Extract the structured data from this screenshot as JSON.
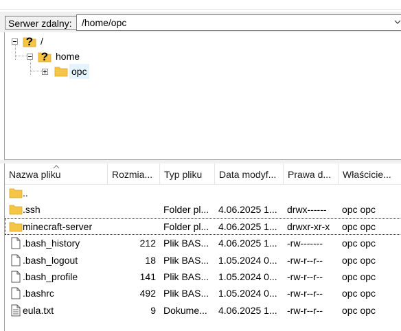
{
  "path_bar": {
    "label": "Serwer zdalny:",
    "value": "/home/opc"
  },
  "tree": [
    {
      "label": "/"
    },
    {
      "label": "home"
    },
    {
      "label": "opc"
    }
  ],
  "columns": {
    "name": "Nazwa pliku",
    "size": "Rozmia...",
    "type": "Typ pliku",
    "date": "Data modyf...",
    "perm": "Prawa d...",
    "owner": "Właścicie..."
  },
  "rows": [
    {
      "icon": "folder-icon",
      "name": "..",
      "size": "",
      "type": "",
      "date": "",
      "perm": "",
      "owner": ""
    },
    {
      "icon": "folder-icon",
      "name": ".ssh",
      "size": "",
      "type": "Folder pl...",
      "date": "4.06.2025 1...",
      "perm": "drwx------",
      "owner": "opc opc"
    },
    {
      "icon": "folder-icon",
      "name": "minecraft-server",
      "size": "",
      "type": "Folder pl...",
      "date": "4.06.2025 1...",
      "perm": "drwxr-xr-x",
      "owner": "opc opc"
    },
    {
      "icon": "file-icon",
      "name": ".bash_history",
      "size": "212",
      "type": "Plik BAS...",
      "date": "4.06.2025 1...",
      "perm": "-rw-------",
      "owner": "opc opc"
    },
    {
      "icon": "file-icon",
      "name": ".bash_logout",
      "size": "18",
      "type": "Plik BAS...",
      "date": "1.05.2024 0...",
      "perm": "-rw-r--r--",
      "owner": "opc opc"
    },
    {
      "icon": "file-icon",
      "name": ".bash_profile",
      "size": "141",
      "type": "Plik BAS...",
      "date": "1.05.2024 0...",
      "perm": "-rw-r--r--",
      "owner": "opc opc"
    },
    {
      "icon": "file-icon",
      "name": ".bashrc",
      "size": "492",
      "type": "Plik BAS...",
      "date": "1.05.2024 0...",
      "perm": "-rw-r--r--",
      "owner": "opc opc"
    },
    {
      "icon": "text-file-icon",
      "name": "eula.txt",
      "size": "9",
      "type": "Dokume...",
      "date": "4.06.2025 1...",
      "perm": "-rw-r--r--",
      "owner": "opc opc"
    }
  ],
  "focused_row": "minecraft-server",
  "colors": {
    "folder": "#f6c546",
    "question": "#000000",
    "selected_bg": "#e5f3ff",
    "border": "#a0a0a0"
  }
}
